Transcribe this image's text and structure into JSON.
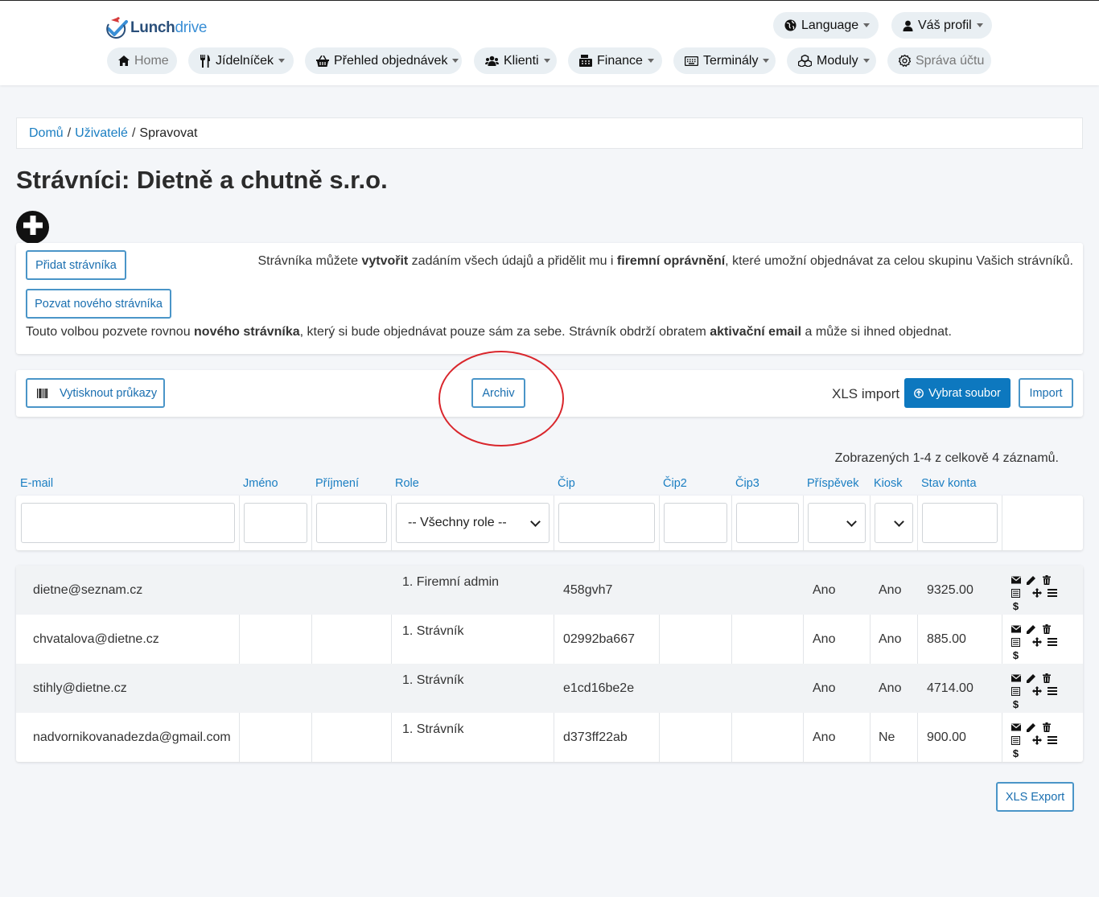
{
  "header": {
    "logo_text_a": "Lunch",
    "logo_text_b": "drive",
    "language_label": "Language",
    "profile_label": "Váš profil",
    "nav": [
      {
        "label": "Home"
      },
      {
        "label": "Jídelníček"
      },
      {
        "label": "Přehled objednávek"
      },
      {
        "label": "Klienti"
      },
      {
        "label": "Finance"
      },
      {
        "label": "Terminály"
      },
      {
        "label": "Moduly"
      },
      {
        "label": "Správa účtu"
      }
    ]
  },
  "breadcrumb": {
    "home": "Domů",
    "users": "Uživatelé",
    "current": "Spravovat",
    "sep": "/"
  },
  "page_title": "Strávníci: Dietně a chutně s.r.o.",
  "add_card": {
    "add_button": "Přidat strávníka",
    "invite_button": "Pozvat nového strávníka",
    "info_right": {
      "p1": "Strávníka můžete ",
      "b1": "vytvořit",
      "p2": " zadáním všech údajů a přidělit mu i ",
      "b2": "firemní oprávnění",
      "p3": ", které umožní objednávat za celou skupinu Vašich strávníků."
    },
    "info_bottom": {
      "p1": "Touto volbou pozvete rovnou ",
      "b1": "nového strávníka",
      "p2": ", který si bude objednávat pouze sám za sebe. Strávník obdrží obratem ",
      "b2": "aktivační email",
      "p3": " a může si ihned objednat."
    }
  },
  "toolbar": {
    "print_cards": "Vytisknout průkazy",
    "archive": "Archiv",
    "xls_import_label": "XLS import",
    "choose_file": "Vybrat soubor",
    "import": "Import"
  },
  "summary": "Zobrazených 1-4 z celkově 4 záznamů.",
  "table": {
    "columns": [
      "E-mail",
      "Jméno",
      "Příjmení",
      "Role",
      "Čip",
      "Čip2",
      "Čip3",
      "Příspěvek",
      "Kiosk",
      "Stav konta"
    ],
    "role_filter": "-- Všechny role --",
    "rows": [
      {
        "email": "dietne@seznam.cz",
        "jmeno": "",
        "prijmeni": "",
        "role": "1. Firemní admin",
        "cip": "458gvh7",
        "cip2": "",
        "cip3": "",
        "prispevek": "Ano",
        "kiosk": "Ano",
        "stav": "9325.00"
      },
      {
        "email": "chvatalova@dietne.cz",
        "jmeno": "",
        "prijmeni": "",
        "role": "1. Strávník",
        "cip": "02992ba667",
        "cip2": "",
        "cip3": "",
        "prispevek": "Ano",
        "kiosk": "Ano",
        "stav": "885.00"
      },
      {
        "email": "stihly@dietne.cz",
        "jmeno": "",
        "prijmeni": "",
        "role": "1. Strávník",
        "cip": "e1cd16be2e",
        "cip2": "",
        "cip3": "",
        "prispevek": "Ano",
        "kiosk": "Ano",
        "stav": "4714.00"
      },
      {
        "email": "nadvornikovanadezda@gmail.com",
        "jmeno": "",
        "prijmeni": "",
        "role": "1. Strávník",
        "cip": "d373ff22ab",
        "cip2": "",
        "cip3": "",
        "prispevek": "Ano",
        "kiosk": "Ne",
        "stav": "900.00"
      }
    ],
    "row_actions": [
      "envelope-icon",
      "pencil-icon",
      "trash-icon",
      "list-icon",
      "move-icon",
      "menu-icon",
      "dollar-icon"
    ],
    "dollar_glyph": "$"
  },
  "xls_export": "XLS Export"
}
